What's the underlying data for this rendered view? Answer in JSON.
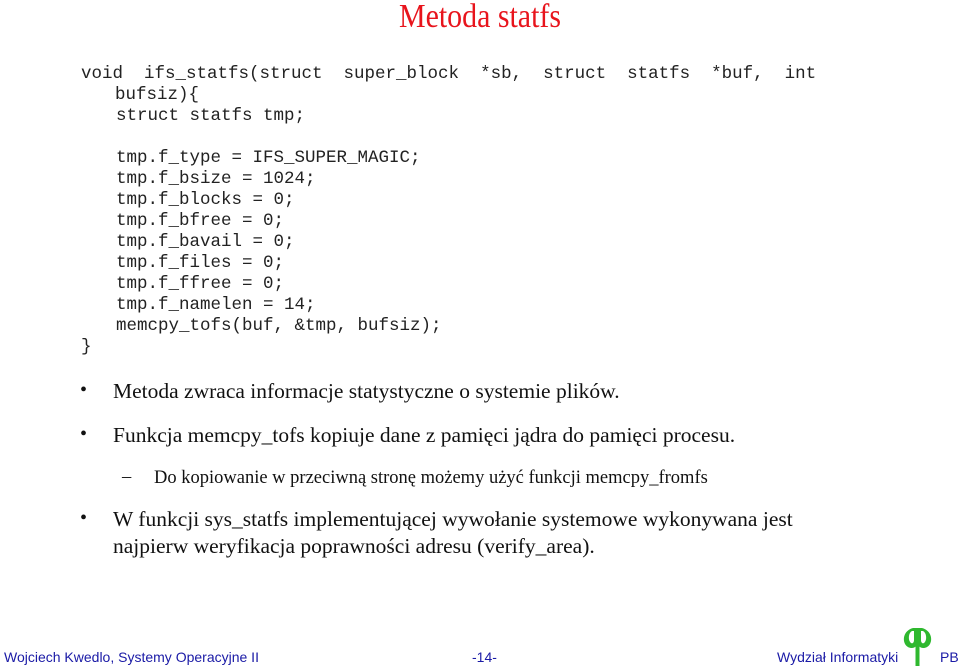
{
  "slide": {
    "title": "Metoda statfs",
    "code_lines": [
      "void  ifs_statfs(struct  super_block  *sb,  struct  statfs  *buf,  int",
      "bufsiz){",
      "struct statfs tmp;",
      "",
      "tmp.f_type = IFS_SUPER_MAGIC;",
      "tmp.f_bsize = 1024;",
      "tmp.f_blocks = 0;",
      "tmp.f_bfree = 0;",
      "tmp.f_bavail = 0;",
      "tmp.f_files = 0;",
      "tmp.f_ffree = 0;",
      "tmp.f_namelen = 14;",
      "memcpy_tofs(buf, &tmp, bufsiz);",
      "}"
    ],
    "bullets": [
      {
        "marker": "•",
        "text": "Metoda zwraca informacje statystyczne o systemie plików."
      },
      {
        "marker": "•",
        "text": "Funkcja memcpy_tofs kopiuje dane z pamięci jądra  do pamięci procesu."
      },
      {
        "marker": "–",
        "text": "Do kopiowanie w przeciwną stronę możemy użyć funkcji memcpy_fromfs"
      },
      {
        "marker": "•",
        "text": "W funkcji sys_statfs implementującej wywołanie systemowe wykonywana jest",
        "text2": "najpierw weryfikacja poprawności adresu (verify_area)."
      }
    ]
  },
  "footer": {
    "left": "Wojciech Kwedlo, Systemy Operacyjne II",
    "center": "-14-",
    "right": "Wydział Informatyki",
    "logo_text": "PB",
    "logo_icon": "pb-logo-icon"
  },
  "colors": {
    "title": "#e8141c",
    "footer_text": "#1a1aa6",
    "logo_green": "#2fb82f"
  }
}
